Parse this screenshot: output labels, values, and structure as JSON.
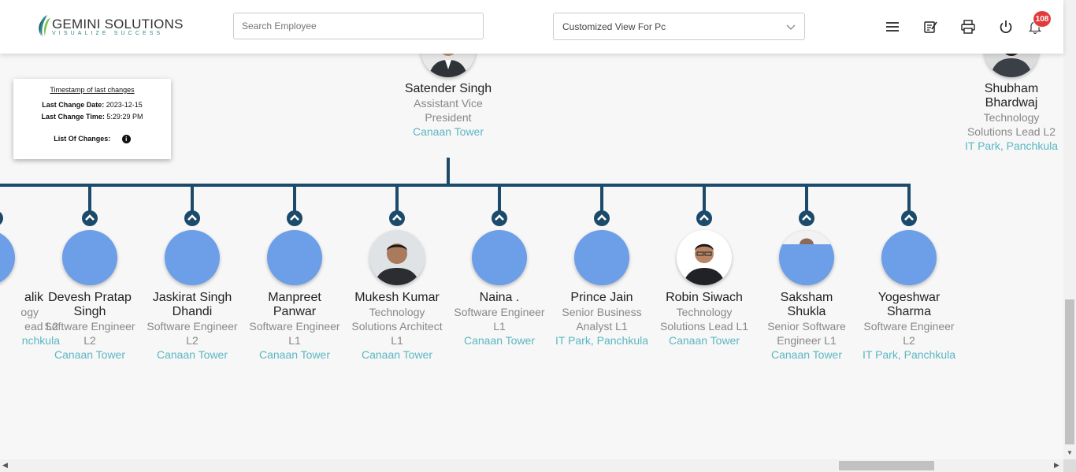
{
  "header": {
    "logo_main": "GEMINI SOLUTIONS",
    "logo_tagline": "VISUALIZE SUCCESS",
    "search_placeholder": "Search Employee",
    "view_selected": "Customized View For Pc",
    "notification_count": "108",
    "icons": [
      "menu-icon",
      "notes-icon",
      "print-icon",
      "power-icon",
      "bell-icon"
    ]
  },
  "timestamp_card": {
    "title": "Timestamp of last changes",
    "date_label": "Last Change Date:",
    "date_value": "2023-12-15",
    "time_label": "Last Change Time:",
    "time_value": "5:29:29 PM",
    "changes_label": "List Of Changes:"
  },
  "manager": {
    "name": "Satender Singh",
    "role_line1": "Assistant Vice",
    "role_line2": "President",
    "location": "Canaan Tower"
  },
  "peer": {
    "name_line1": "Shubham",
    "name_line2": "Bhardwaj",
    "role_line1": "Technology",
    "role_line2": "Solutions Lead L2",
    "location": "IT Park, Panchkula"
  },
  "reports": [
    {
      "name1": "alik",
      "name2": "",
      "role1": "ogy",
      "role2": "ead L2",
      "location": "nchkula"
    },
    {
      "name1": "Devesh Pratap",
      "name2": "Singh",
      "role1": "Software Engineer",
      "role2": "L2",
      "location": "Canaan Tower"
    },
    {
      "name1": "Jaskirat Singh",
      "name2": "Dhandi",
      "role1": "Software Engineer",
      "role2": "L2",
      "location": "Canaan Tower"
    },
    {
      "name1": "Manpreet",
      "name2": "Panwar",
      "role1": "Software Engineer",
      "role2": "L1",
      "location": "Canaan Tower"
    },
    {
      "name1": "Mukesh Kumar",
      "name2": "",
      "role1": "Technology",
      "role2": "Solutions Architect",
      "role3": "L1",
      "location": "Canaan Tower"
    },
    {
      "name1": "Naina .",
      "name2": "",
      "role1": "Software Engineer",
      "role2": "L1",
      "location": "Canaan Tower"
    },
    {
      "name1": "Prince Jain",
      "name2": "",
      "role1": "Senior Business",
      "role2": "Analyst L1",
      "location": "IT Park, Panchkula"
    },
    {
      "name1": "Robin Siwach",
      "name2": "",
      "role1": "Technology",
      "role2": "Solutions Lead L1",
      "location": "Canaan Tower"
    },
    {
      "name1": "Saksham",
      "name2": "Shukla",
      "role1": "Senior Software",
      "role2": "Engineer L1",
      "location": "Canaan Tower"
    },
    {
      "name1": "Yogeshwar",
      "name2": "Sharma",
      "role1": "Software Engineer",
      "role2": "L2",
      "location": "IT Park, Panchkula"
    }
  ],
  "colors": {
    "connector": "#1b4a6b",
    "avatar_placeholder": "#6d9ee8",
    "location_text": "#5bb7c2",
    "badge": "#e23b3b"
  }
}
